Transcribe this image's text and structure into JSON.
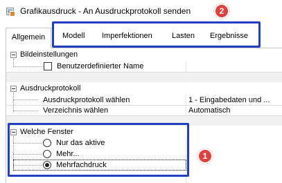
{
  "window": {
    "title": "Grafikausdruck - An Ausdruckprotokoll senden"
  },
  "callouts": {
    "badge_1": "1",
    "badge_2": "2"
  },
  "tabs": [
    {
      "label": "Allgemein",
      "active": true
    },
    {
      "label": "Modell",
      "active": false
    },
    {
      "label": "Imperfektionen",
      "active": false
    },
    {
      "label": "Lasten",
      "active": false
    },
    {
      "label": "Ergebnisse",
      "active": false
    }
  ],
  "groups": {
    "bildeinstellungen": {
      "title": "Bildeinstellungen",
      "items": [
        {
          "label": "Benutzerdefinierter Name",
          "checked": false
        }
      ]
    },
    "ausdruckprotokoll": {
      "title": "Ausdruckprotokoll",
      "rows": [
        {
          "label": "Ausdruckprotokoll wählen",
          "value": "1 - Eingabedaten und ..."
        },
        {
          "label": "Verzeichnis wählen",
          "value": "Automatisch"
        }
      ]
    },
    "welche_fenster": {
      "title": "Welche Fenster",
      "options": [
        {
          "label": "Nur das aktive",
          "selected": false
        },
        {
          "label": "Mehr...",
          "selected": false
        },
        {
          "label": "Mehrfachdruck",
          "selected": true
        }
      ]
    }
  },
  "colors": {
    "highlight_border": "#1f3fbf",
    "badge_fill": "#e04040",
    "grid_band": "#f0f0f0"
  }
}
